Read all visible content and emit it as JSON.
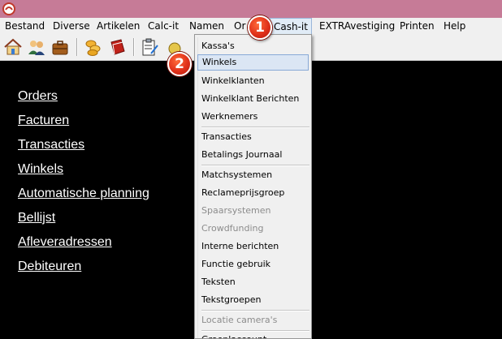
{
  "menubar": {
    "items": [
      "Bestand",
      "Diverse",
      "Artikelen",
      "Calc-it",
      "Namen",
      "Or",
      "Cash-it",
      "EXTRAvestiging",
      "Printen",
      "Help"
    ]
  },
  "toolbar": {
    "buttons": [
      "home-icon",
      "users-icon",
      "briefcase-icon",
      "coins-icon",
      "book-icon",
      "clipboard-icon"
    ]
  },
  "dropdown": {
    "items": [
      {
        "label": "Kassa's",
        "disabled": false
      },
      {
        "label": "Winkels",
        "disabled": false,
        "selected": true
      },
      {
        "label": "Winkelklanten",
        "disabled": false
      },
      {
        "label": "Winkelklant Berichten",
        "disabled": false
      },
      {
        "label": "Werknemers",
        "disabled": false
      },
      {
        "label": "Transacties",
        "disabled": false
      },
      {
        "label": "Betalings Journaal",
        "disabled": false
      },
      {
        "label": "Matchsystemen",
        "disabled": false
      },
      {
        "label": "Reclameprijsgroep",
        "disabled": false
      },
      {
        "label": "Spaarsystemen",
        "disabled": true
      },
      {
        "label": "Crowdfunding",
        "disabled": true
      },
      {
        "label": "Interne berichten",
        "disabled": false
      },
      {
        "label": "Functie gebruik",
        "disabled": false
      },
      {
        "label": "Teksten",
        "disabled": false
      },
      {
        "label": "Tekstgroepen",
        "disabled": false
      },
      {
        "label": "Locatie camera's",
        "disabled": true
      },
      {
        "label": "Groeplaccount",
        "disabled": false
      }
    ]
  },
  "links": [
    "Orders",
    "Facturen",
    "Transacties",
    "Winkels",
    "Automatische planning",
    "Bellijst",
    "Afleveradressen",
    "Debiteuren"
  ],
  "badges": [
    "1",
    "2"
  ],
  "colors": {
    "titlebar": "#c67b97",
    "badge": "#e0311a",
    "selection": "#dbe6f4"
  }
}
